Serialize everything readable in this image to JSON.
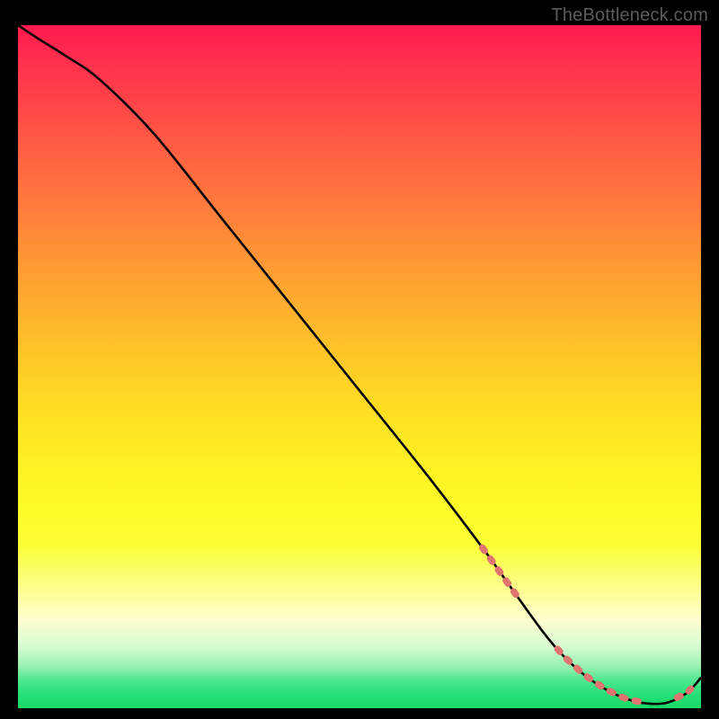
{
  "watermark": "TheBottleneck.com",
  "chart_data": {
    "type": "line",
    "title": "",
    "xlabel": "",
    "ylabel": "",
    "xlim": [
      0,
      100
    ],
    "ylim": [
      0,
      100
    ],
    "series": [
      {
        "name": "curve",
        "x": [
          0,
          3,
          7,
          12,
          20,
          30,
          40,
          50,
          60,
          68,
          73,
          77,
          80,
          83,
          86,
          89,
          92,
          95,
          98,
          100
        ],
        "y": [
          100,
          98,
          95.5,
          92,
          84,
          71.5,
          59,
          46.5,
          34,
          23.5,
          16.5,
          11,
          7.5,
          4.8,
          2.8,
          1.4,
          0.7,
          0.8,
          2.3,
          4.5
        ]
      }
    ],
    "dash_segments": [
      {
        "x_start": 68,
        "x_end": 73.5
      },
      {
        "x_start": 79,
        "x_end": 91
      },
      {
        "x_start": 96.5,
        "x_end": 98.5
      }
    ],
    "colors": {
      "curve": "#000000",
      "dash": "#e0746f",
      "gradient_top": "#ff1a4f",
      "gradient_bottom": "#18d968"
    }
  }
}
